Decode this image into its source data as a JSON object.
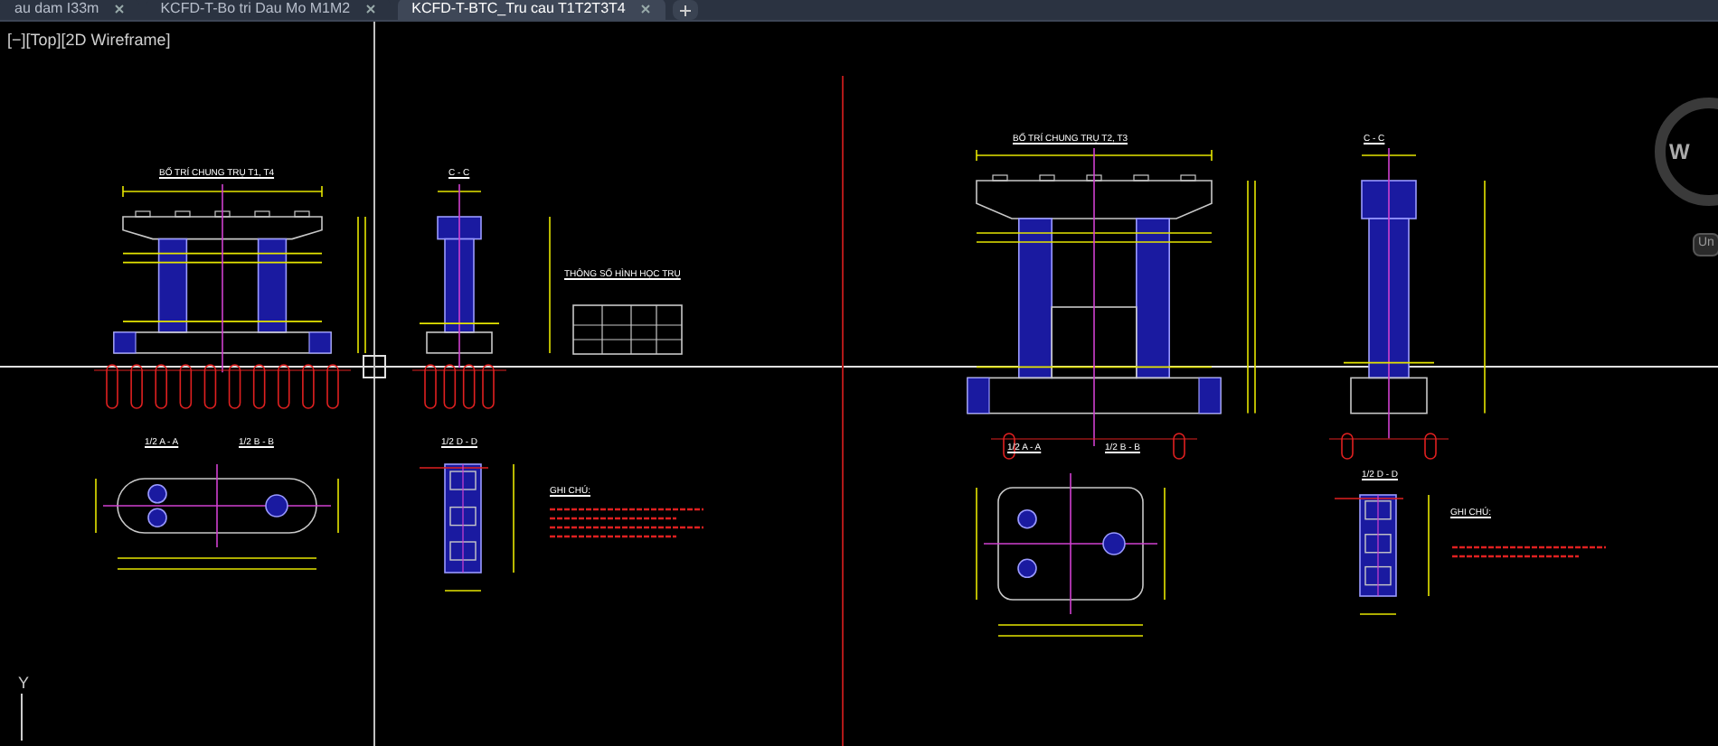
{
  "tabs": [
    {
      "label": "au dam I33m",
      "selected": false
    },
    {
      "label": "KCFD-T-Bo tri Dau Mo M1M2",
      "selected": false
    },
    {
      "label": "KCFD-T-BTC_Tru cau T1T2T3T4",
      "selected": true
    }
  ],
  "viewport": {
    "label": "[−][Top][2D Wireframe]"
  },
  "viewcube": {
    "direction": "W",
    "button": "Un"
  },
  "ucs": {
    "axis": "Y"
  },
  "sheets": [
    {
      "elevation_title": "BỐ TRÍ CHUNG TRỤ T1, T4",
      "section_title": "C - C",
      "table_title": "THÔNG SỐ HÌNH HỌC TRỤ",
      "plan_titles": [
        "1/2 A - A",
        "1/2 B - B"
      ],
      "detail_title": "1/2 D - D",
      "notes_title": "GHI CHÚ:"
    },
    {
      "elevation_title": "BỐ TRÍ CHUNG TRỤ T2, T3",
      "section_title": "C - C",
      "plan_titles": [
        "1/2 A - A",
        "1/2 B - B"
      ],
      "detail_title": "1/2 D - D",
      "notes_title": "GHI CHÚ:"
    }
  ]
}
